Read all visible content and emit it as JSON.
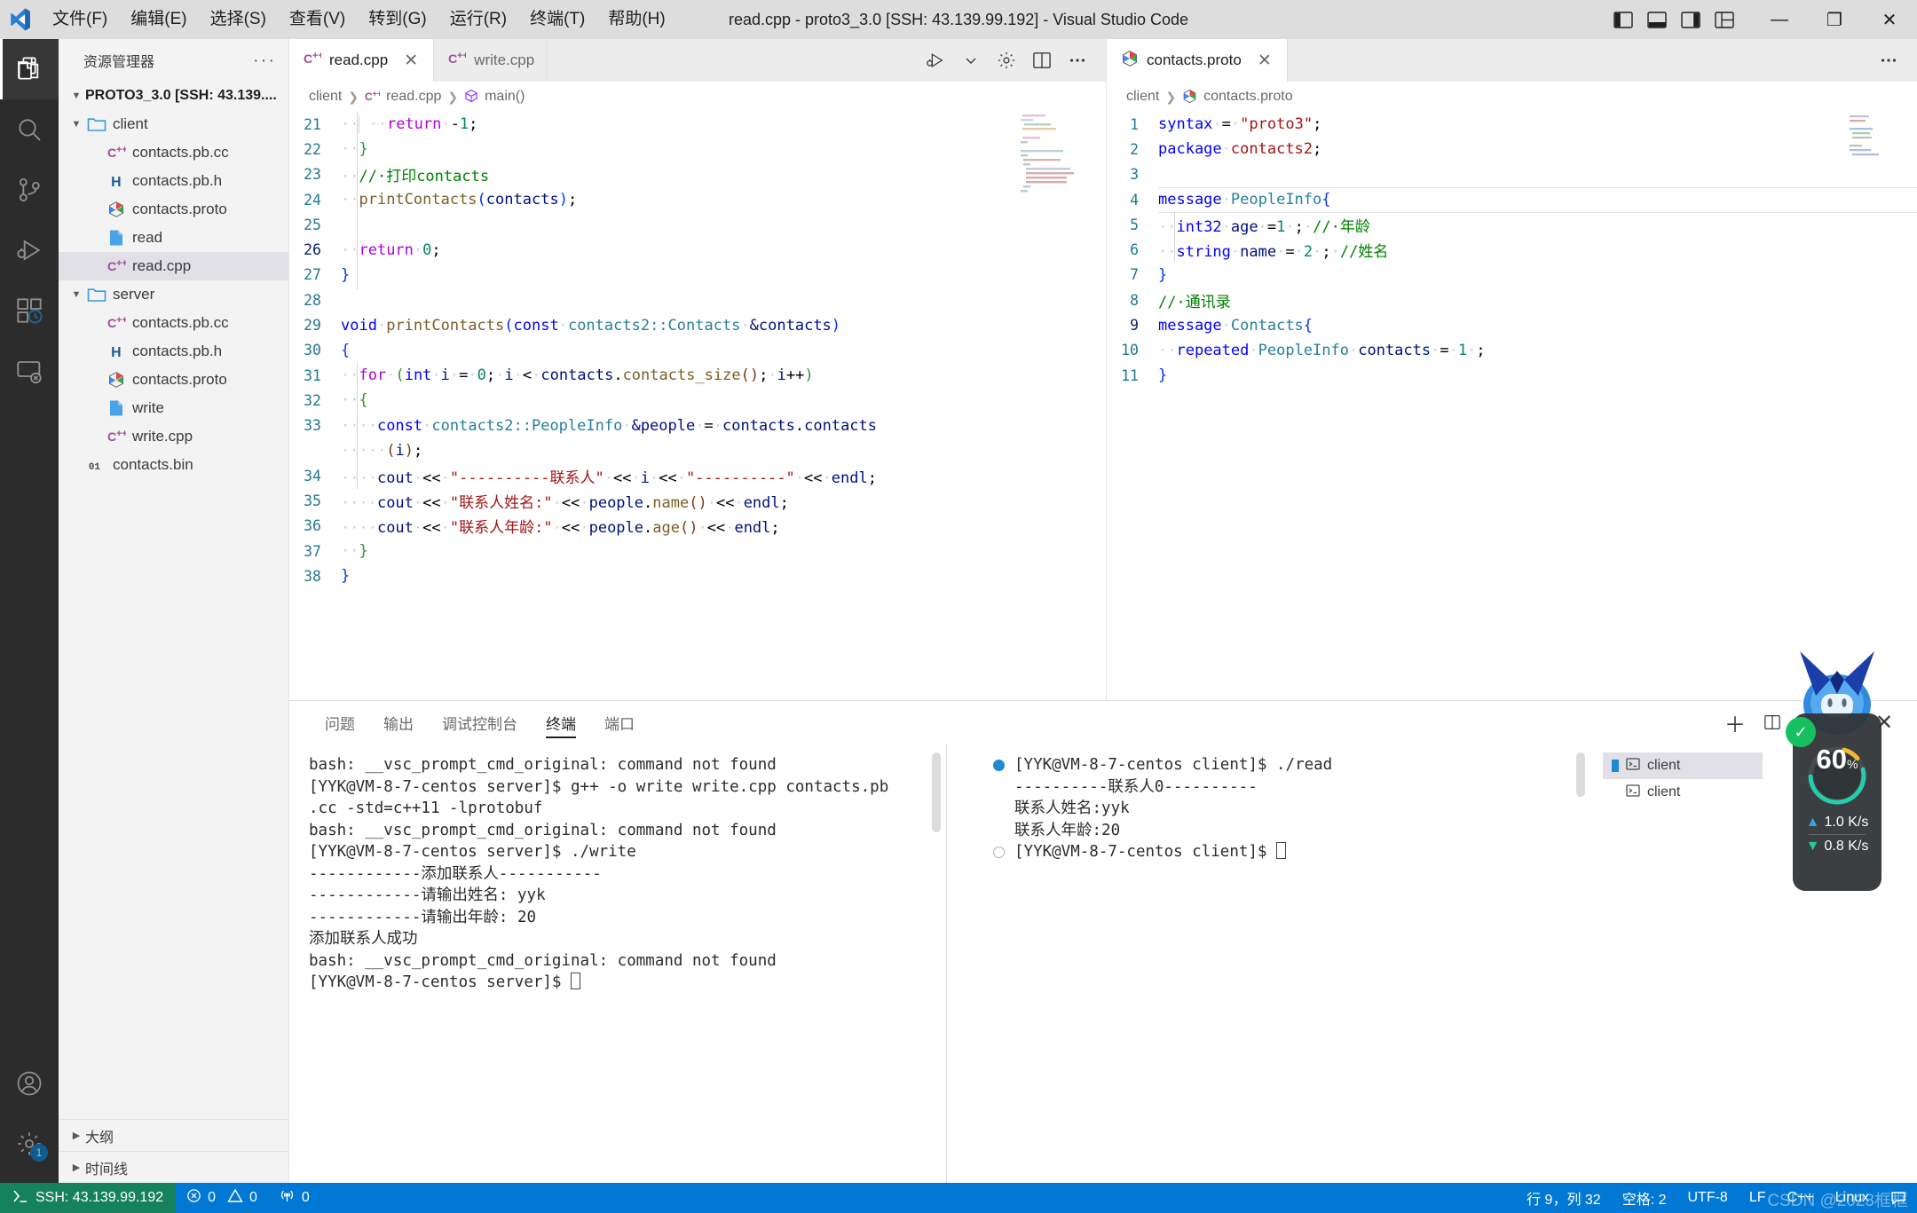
{
  "window": {
    "title": "read.cpp - proto3_3.0 [SSH: 43.139.99.192] - Visual Studio Code",
    "minimize": "—",
    "maximize": "❐",
    "close": "✕"
  },
  "menubar": {
    "items": [
      {
        "label": "文件(F)",
        "name": "menu-file"
      },
      {
        "label": "编辑(E)",
        "name": "menu-edit"
      },
      {
        "label": "选择(S)",
        "name": "menu-selection"
      },
      {
        "label": "查看(V)",
        "name": "menu-view"
      },
      {
        "label": "转到(G)",
        "name": "menu-go"
      },
      {
        "label": "运行(R)",
        "name": "menu-run"
      },
      {
        "label": "终端(T)",
        "name": "menu-terminal"
      },
      {
        "label": "帮助(H)",
        "name": "menu-help"
      }
    ]
  },
  "activitybar": {
    "items": [
      {
        "name": "explorer",
        "icon": "files-icon",
        "active": true
      },
      {
        "name": "search",
        "icon": "search-icon",
        "active": false
      },
      {
        "name": "source-control",
        "icon": "source-control-icon",
        "active": false
      },
      {
        "name": "run-debug",
        "icon": "run-debug-icon",
        "active": false
      },
      {
        "name": "extensions",
        "icon": "extensions-icon",
        "active": false
      },
      {
        "name": "remote-explorer",
        "icon": "remote-explorer-icon",
        "active": false
      }
    ],
    "bottom": [
      {
        "name": "accounts",
        "icon": "account-icon",
        "badge": ""
      },
      {
        "name": "settings",
        "icon": "gear-icon",
        "badge": "1"
      }
    ]
  },
  "sidebar": {
    "title": "资源管理器",
    "more_label": "···",
    "root": "PROTO3_3.0 [SSH: 43.139....",
    "tree": [
      {
        "label": "client",
        "icon": "folder-icon",
        "kind": "folder",
        "indent": 1,
        "expanded": true,
        "selected": false
      },
      {
        "label": "contacts.pb.cc",
        "icon": "cpp-icon",
        "kind": "file",
        "indent": 2,
        "selected": false
      },
      {
        "label": "contacts.pb.h",
        "icon": "h-icon",
        "kind": "file",
        "indent": 2,
        "selected": false
      },
      {
        "label": "contacts.proto",
        "icon": "proto-icon",
        "kind": "file",
        "indent": 2,
        "selected": false
      },
      {
        "label": "read",
        "icon": "binary-icon",
        "kind": "file",
        "indent": 2,
        "selected": false
      },
      {
        "label": "read.cpp",
        "icon": "cpp-icon",
        "kind": "file",
        "indent": 2,
        "selected": true
      },
      {
        "label": "server",
        "icon": "folder-icon",
        "kind": "folder",
        "indent": 1,
        "expanded": true,
        "selected": false
      },
      {
        "label": "contacts.pb.cc",
        "icon": "cpp-icon",
        "kind": "file",
        "indent": 2,
        "selected": false
      },
      {
        "label": "contacts.pb.h",
        "icon": "h-icon",
        "kind": "file",
        "indent": 2,
        "selected": false
      },
      {
        "label": "contacts.proto",
        "icon": "proto-icon",
        "kind": "file",
        "indent": 2,
        "selected": false
      },
      {
        "label": "write",
        "icon": "binary-icon",
        "kind": "file",
        "indent": 2,
        "selected": false
      },
      {
        "label": "write.cpp",
        "icon": "cpp-icon",
        "kind": "file",
        "indent": 2,
        "selected": false
      },
      {
        "label": "contacts.bin",
        "icon": "bin-icon",
        "kind": "file",
        "indent": 1,
        "selected": false
      }
    ],
    "sections": [
      {
        "label": "大纲",
        "name": "outline-section"
      },
      {
        "label": "时间线",
        "name": "timeline-section"
      }
    ]
  },
  "editor_left": {
    "tabs": [
      {
        "label": "read.cpp",
        "icon": "cpp-icon",
        "active": true,
        "close": "✕"
      },
      {
        "label": "write.cpp",
        "icon": "cpp-icon",
        "active": false,
        "close": "✕"
      }
    ],
    "actions": [
      {
        "name": "run-and-debug-button",
        "icon": "run-debug-icon"
      },
      {
        "name": "run-dropdown-button",
        "icon": "chevron-down-icon"
      },
      {
        "name": "settings-button",
        "icon": "gear-icon"
      },
      {
        "name": "split-editor-button",
        "icon": "split-editor-icon"
      },
      {
        "name": "more-actions-button",
        "icon": "ellipsis-icon"
      }
    ],
    "breadcrumb": [
      "client",
      "read.cpp",
      "main()"
    ],
    "first_line": 21,
    "cursor_line": 26,
    "lines": [
      {
        "n": 21,
        "html": "<span class=\"ws\">··</span><span class=\"guide\" style=\"padding-left:10px\"></span><span class=\"ws\">··</span><span class=\"kc\">return</span><span class=\"ws\">·</span><span class=\"op\">-</span><span class=\"nu\">1</span><span class=\"op\">;</span>"
      },
      {
        "n": 22,
        "html": "<span class=\"ws\">··</span><span class=\"brk2\">}</span>"
      },
      {
        "n": 23,
        "html": "<span class=\"ws\">··</span><span class=\"cm\">//·打印contacts</span>"
      },
      {
        "n": 24,
        "html": "<span class=\"ws\">··</span><span class=\"fn\">printContacts</span><span class=\"brk1\">(</span><span class=\"va\">contacts</span><span class=\"brk1\">)</span><span class=\"op\">;</span>"
      },
      {
        "n": 25,
        "html": ""
      },
      {
        "n": 26,
        "html": "<span class=\"ws\">··</span><span class=\"kc\">return</span><span class=\"ws\">·</span><span class=\"nu\">0</span><span class=\"op\">;</span>"
      },
      {
        "n": 27,
        "html": "<span class=\"brk1\">}</span>"
      },
      {
        "n": 28,
        "html": ""
      },
      {
        "n": 29,
        "html": "<span class=\"k\">void</span><span class=\"ws\">·</span><span class=\"fn\">printContacts</span><span class=\"brk1\">(</span><span class=\"k\">const</span><span class=\"ws\">·</span><span class=\"ty\">contacts2::Contacts</span><span class=\"ws\">·</span><span class=\"va\">&amp;contacts</span><span class=\"brk1\">)</span>"
      },
      {
        "n": 30,
        "html": "<span class=\"brk1\">{</span>"
      },
      {
        "n": 31,
        "html": "<span class=\"ws\">··</span><span class=\"kc\">for</span><span class=\"ws\">·</span><span class=\"brk2\">(</span><span class=\"k\">int</span><span class=\"ws\">·</span><span class=\"va\">i</span><span class=\"ws\">·</span><span class=\"op\">=</span><span class=\"ws\">·</span><span class=\"nu\">0</span><span class=\"op\">;</span><span class=\"ws\">·</span><span class=\"va\">i</span><span class=\"ws\">·</span><span class=\"op\">&lt;</span><span class=\"ws\">·</span><span class=\"va\">contacts</span><span class=\"op\">.</span><span class=\"fn\">contacts_size</span><span class=\"brk3\">()</span><span class=\"op\">;</span><span class=\"ws\">·</span><span class=\"va\">i</span><span class=\"op\">++</span><span class=\"brk2\">)</span>"
      },
      {
        "n": 32,
        "html": "<span class=\"ws\">··</span><span class=\"brk2\">{</span>"
      },
      {
        "n": 33,
        "html": "<span class=\"ws\">····</span><span class=\"k\">const</span><span class=\"ws\">·</span><span class=\"ty\">contacts2::PeopleInfo</span><span class=\"ws\">·</span><span class=\"va\">&amp;people</span><span class=\"ws\">·</span><span class=\"op\">=</span><span class=\"ws\">·</span><span class=\"va\">contacts</span><span class=\"op\">.</span><span class=\"va\">contacts</span>"
      },
      {
        "n": "",
        "html": "<span class=\"ws\">·····</span><span class=\"brk3\">(</span><span class=\"va\">i</span><span class=\"brk3\">)</span><span class=\"op\">;</span>"
      },
      {
        "n": 34,
        "html": "<span class=\"ws\">····</span><span class=\"va\">cout</span><span class=\"ws\">·</span><span class=\"op\">&lt;&lt;</span><span class=\"ws\">·</span><span class=\"st\">\"----------联系人\"</span><span class=\"ws\">·</span><span class=\"op\">&lt;&lt;</span><span class=\"ws\">·</span><span class=\"va\">i</span><span class=\"ws\">·</span><span class=\"op\">&lt;&lt;</span><span class=\"ws\">·</span><span class=\"st\">\"----------\"</span><span class=\"ws\">·</span><span class=\"op\">&lt;&lt;</span><span class=\"ws\">·</span><span class=\"va\">endl</span><span class=\"op\">;</span>"
      },
      {
        "n": 35,
        "html": "<span class=\"ws\">····</span><span class=\"va\">cout</span><span class=\"ws\">·</span><span class=\"op\">&lt;&lt;</span><span class=\"ws\">·</span><span class=\"st\">\"联系人姓名:\"</span><span class=\"ws\">·</span><span class=\"op\">&lt;&lt;</span><span class=\"ws\">·</span><span class=\"va\">people</span><span class=\"op\">.</span><span class=\"fn\">name</span><span class=\"brk3\">()</span><span class=\"ws\">·</span><span class=\"op\">&lt;&lt;</span><span class=\"ws\">·</span><span class=\"va\">endl</span><span class=\"op\">;</span>"
      },
      {
        "n": 36,
        "html": "<span class=\"ws\">····</span><span class=\"va\">cout</span><span class=\"ws\">·</span><span class=\"op\">&lt;&lt;</span><span class=\"ws\">·</span><span class=\"st\">\"联系人年龄:\"</span><span class=\"ws\">·</span><span class=\"op\">&lt;&lt;</span><span class=\"ws\">·</span><span class=\"va\">people</span><span class=\"op\">.</span><span class=\"fn\">age</span><span class=\"brk3\">()</span><span class=\"ws\">·</span><span class=\"op\">&lt;&lt;</span><span class=\"ws\">·</span><span class=\"va\">endl</span><span class=\"op\">;</span>"
      },
      {
        "n": 37,
        "html": "<span class=\"ws\">··</span><span class=\"brk2\">}</span>"
      },
      {
        "n": 38,
        "html": "<span class=\"brk1\">}</span>"
      }
    ],
    "plain_lines": [
      "    return -1;",
      "  }",
      "  // 打印contacts",
      "  printContacts(contacts);",
      "",
      "  return 0;",
      "}",
      "",
      "void printContacts(const contacts2::Contacts &contacts)",
      "{",
      "  for (int i = 0; i < contacts.contacts_size(); i++)",
      "  {",
      "    const contacts2::PeopleInfo &people = contacts.contacts(i);",
      "    cout << \"----------联系人\" << i << \"----------\" << endl;",
      "    cout << \"联系人姓名:\" << people.name() << endl;",
      "    cout << \"联系人年龄:\" << people.age() << endl;",
      "  }",
      "}"
    ]
  },
  "editor_right": {
    "tabs": [
      {
        "label": "contacts.proto",
        "icon": "proto-icon",
        "active": true,
        "close": "✕"
      }
    ],
    "more_label": "···",
    "breadcrumb": [
      "client",
      "contacts.proto"
    ],
    "cursor_line": 9,
    "lines": [
      {
        "n": 1,
        "html": "<span class=\"k\">syntax</span><span class=\"ws\">·</span><span class=\"op\">=</span><span class=\"ws\">·</span><span class=\"st\">\"proto3\"</span><span class=\"op\">;</span>"
      },
      {
        "n": 2,
        "html": "<span class=\"k\">package</span><span class=\"ws\">·</span><span class=\"st\">contacts2</span><span class=\"op\">;</span>"
      },
      {
        "n": 3,
        "html": ""
      },
      {
        "n": 4,
        "html": "<span class=\"k\">message</span><span class=\"ws\">·</span><span class=\"ty\">PeopleInfo</span><span class=\"brk1\">{</span>"
      },
      {
        "n": 5,
        "html": "<span class=\"ws\">··</span><span class=\"k\">int32</span><span class=\"ws\">·</span><span class=\"va\">age</span><span class=\"ws\">·</span><span class=\"op\">=</span><span class=\"nu\">1</span><span class=\"ws\">·</span><span class=\"op\">;</span><span class=\"ws\">·</span><span class=\"cm\">//·年龄</span>"
      },
      {
        "n": 6,
        "html": "<span class=\"ws\">··</span><span class=\"k\">string</span><span class=\"ws\">·</span><span class=\"va\">name</span><span class=\"ws\">·</span><span class=\"op\">=</span><span class=\"ws\">·</span><span class=\"nu\">2</span><span class=\"ws\">·</span><span class=\"op\">;</span><span class=\"ws\">·</span><span class=\"cm\">//姓名</span>"
      },
      {
        "n": 7,
        "html": "<span class=\"brk1\">}</span>"
      },
      {
        "n": 8,
        "html": "<span class=\"cm\">//·通讯录</span>"
      },
      {
        "n": 9,
        "html": "<span class=\"k\">message</span><span class=\"ws\">·</span><span class=\"ty\">Contacts</span><span class=\"brk1\">{</span>"
      },
      {
        "n": 10,
        "html": "<span class=\"ws\">··</span><span class=\"k\">repeated</span><span class=\"ws\">·</span><span class=\"ty\">PeopleInfo</span><span class=\"ws\">·</span><span class=\"va\">contacts</span><span class=\"ws\">·</span><span class=\"op\">=</span><span class=\"ws\">·</span><span class=\"nu\">1</span><span class=\"ws\">·</span><span class=\"op\">;</span>"
      },
      {
        "n": 11,
        "html": "<span class=\"brk1\">}</span>"
      }
    ],
    "plain_lines": [
      "syntax = \"proto3\";",
      "package contacts2;",
      "",
      "message PeopleInfo{",
      "  int32 age =1 ; // 年龄",
      "  string name = 2 ; //姓名",
      "}",
      "// 通讯录",
      "message Contacts{",
      "  repeated PeopleInfo contacts = 1 ;",
      "}"
    ]
  },
  "panel": {
    "tabs": [
      {
        "label": "问题",
        "name": "tab-problems",
        "active": false
      },
      {
        "label": "输出",
        "name": "tab-output",
        "active": false
      },
      {
        "label": "调试控制台",
        "name": "tab-debug-console",
        "active": false
      },
      {
        "label": "终端",
        "name": "tab-terminal",
        "active": true
      },
      {
        "label": "端口",
        "name": "tab-ports",
        "active": false
      }
    ],
    "actions": [
      {
        "name": "new-terminal-button",
        "icon": "plus-icon",
        "glyph": "＋"
      },
      {
        "name": "close-panel-button",
        "icon": "close-icon",
        "glyph": "✕"
      }
    ],
    "terminal_left": {
      "lines": [
        "bash: __vsc_prompt_cmd_original: command not found",
        "[YYK@VM-8-7-centos server]$ g++ -o write write.cpp contacts.pb",
        ".cc -std=c++11 -lprotobuf",
        "bash: __vsc_prompt_cmd_original: command not found",
        "[YYK@VM-8-7-centos server]$ ./write",
        "------------添加联系人-----------",
        "------------请输出姓名: yyk",
        "------------请输出年龄: 20",
        "添加联系人成功",
        "bash: __vsc_prompt_cmd_original: command not found",
        "[YYK@VM-8-7-centos server]$ "
      ]
    },
    "terminal_right": {
      "lines": [
        {
          "text": "[YYK@VM-8-7-centos client]$ ./read",
          "marker": "filled"
        },
        {
          "text": "----------联系人0----------",
          "marker": "none"
        },
        {
          "text": "联系人姓名:yyk",
          "marker": "none"
        },
        {
          "text": "联系人年龄:20",
          "marker": "none"
        },
        {
          "text": "[YYK@VM-8-7-centos client]$ ",
          "marker": "empty"
        }
      ]
    },
    "terminal_list": [
      {
        "label": "client",
        "selected": true,
        "icon": "terminal-icon"
      },
      {
        "label": "client",
        "selected": false,
        "icon": "terminal-icon"
      }
    ]
  },
  "statusbar": {
    "remote": "SSH: 43.139.99.192",
    "errors": "0",
    "warnings": "0",
    "ports": "0",
    "cursor_position": "行 9，列 32",
    "indentation": "空格: 2",
    "encoding": "UTF-8",
    "eol": "LF",
    "language": "C++",
    "platform": "Linux",
    "watermark": "CSDN @2023框框"
  },
  "speed_widget": {
    "percent": "60",
    "percent_unit": "%",
    "upload": "1.0 K/s",
    "download": "0.8 K/s",
    "up_arrow": "▲",
    "down_arrow": "▼",
    "shield": "✓"
  },
  "colors": {
    "accent": "#0078d4",
    "remote_green": "#16825d",
    "titlebar": "#dddddd",
    "activitybar": "#2c2c2c",
    "sidebar": "#f3f3f3",
    "tab_inactive": "#ececec",
    "selection": "#e0e0e6"
  }
}
